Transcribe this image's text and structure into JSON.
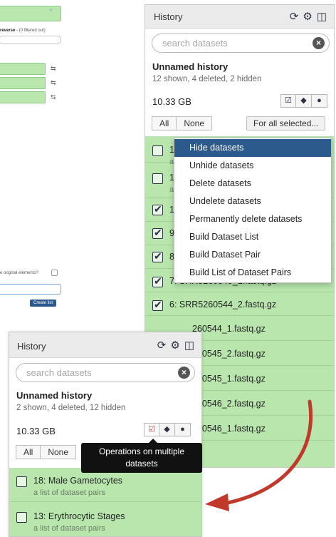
{
  "background_fragment": {
    "reverse_label": "reverse",
    "filtered_note": "- (0 filtered out)",
    "original_elements_question": "e original elements?",
    "create_button": "Create list"
  },
  "top_panel": {
    "title": "History",
    "search_placeholder": "search datasets",
    "history_name": "Unnamed history",
    "counts": "12 shown, 4 deleted, 2 hidden",
    "size": "10.33 GB",
    "btn_all": "All",
    "btn_none": "None",
    "btn_for_all": "For all selected...",
    "dropdown": [
      "Hide datasets",
      "Unhide datasets",
      "Delete datasets",
      "Undelete datasets",
      "Permanently delete datasets",
      "Build Dataset List",
      "Build Dataset Pair",
      "Build List of Dataset Pairs"
    ],
    "partial_rows": [
      {
        "visible": "1",
        "sub": "a"
      },
      {
        "visible": "1",
        "sub": "a"
      },
      {
        "visible": "1"
      },
      {
        "visible": "9"
      },
      {
        "visible": "8"
      }
    ],
    "rows": [
      {
        "title": "7: SRR5260549_1.fastq.gz"
      },
      {
        "title": "6: SRR5260544_2.fastq.gz"
      }
    ],
    "covered_rows": [
      {
        "visible": "260544_1.fastq.gz"
      },
      {
        "visible": "260545_2.fastq.gz"
      },
      {
        "visible": "260545_1.fastq.gz"
      },
      {
        "visible": "260546_2.fastq.gz"
      },
      {
        "visible": "260546_1.fastq.gz"
      }
    ]
  },
  "bottom_panel": {
    "title": "History",
    "search_placeholder": "search datasets",
    "history_name": "Unnamed history",
    "counts": "2 shown, 4 deleted, 12 hidden",
    "size": "10.33 GB",
    "btn_all": "All",
    "btn_none": "None",
    "tooltip": "Operations on multiple datasets",
    "rows": [
      {
        "title": "18: Male Gametocytes",
        "sub": "a list of dataset pairs"
      },
      {
        "title": "13: Erythrocytic Stages",
        "sub": "a list of dataset pairs"
      }
    ]
  },
  "colors": {
    "ok_green": "#b8e6ad",
    "menu_highlight": "#2c5a8c",
    "arrow_red": "#c0392b",
    "tooltip_bg": "#111111"
  },
  "icons": [
    "refresh-icon",
    "gear-icon",
    "columns-icon",
    "close-icon",
    "checkbox-icon",
    "tags-icon",
    "comment-icon",
    "check-icon",
    "link-icon"
  ]
}
